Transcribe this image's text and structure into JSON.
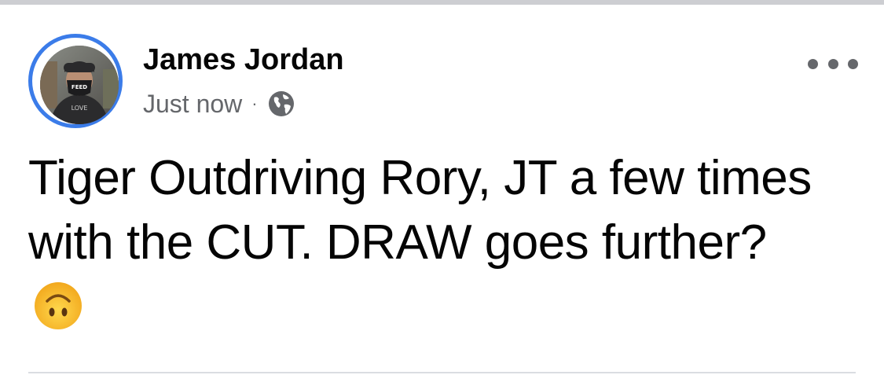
{
  "post": {
    "author_name": "James Jordan",
    "timestamp": "Just now",
    "separator": "·",
    "audience_icon": "globe-icon",
    "more_icon": "more-horizontal-icon",
    "text": "Tiger Outdriving Rory, JT a few times with the CUT. DRAW goes further?",
    "emoji": "upside-down-face-emoji"
  },
  "colors": {
    "avatar_ring": "#3b7ce9",
    "secondary_text": "#65676b",
    "primary_text": "#050505",
    "divider": "#dadde1"
  }
}
